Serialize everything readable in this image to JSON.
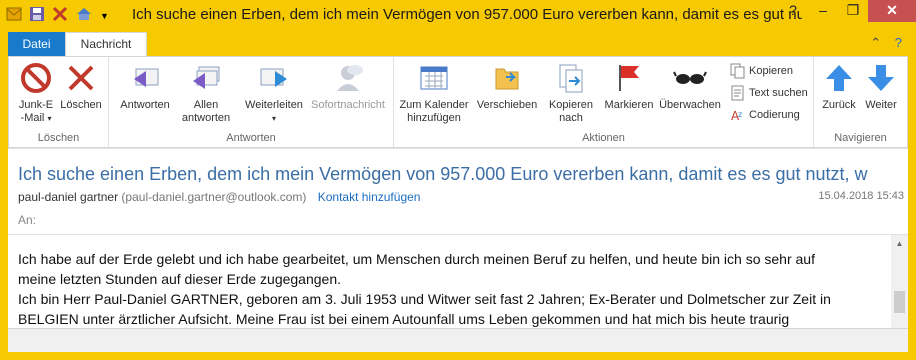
{
  "window": {
    "title": "Ich suche einen Erben, dem ich mein Vermögen von 957.000 Euro vererben kann, damit es es gut nut...",
    "help_icon": "?",
    "controls": [
      "–",
      "❐",
      "✕"
    ]
  },
  "quick_access": {
    "icons": [
      "outlook-icon",
      "save-icon",
      "delete-icon",
      "move-icon",
      "dropdown-icon"
    ]
  },
  "tabs": {
    "file": "Datei",
    "message": "Nachricht"
  },
  "ribbon": {
    "groups": {
      "delete": "Löschen",
      "respond": "Antworten",
      "actions": "Aktionen",
      "navigate": "Navigieren"
    },
    "buttons": {
      "junk": "Junk-E\n-Mail",
      "junk_arrow": "▾",
      "delete": "Löschen",
      "reply": "Antworten",
      "reply_all_1": "Allen",
      "reply_all_2": "antworten",
      "forward": "Weiterleiten",
      "forward_arrow": "▾",
      "instant_message": "Sofortnachricht",
      "calendar_1": "Zum Kalender",
      "calendar_2": "hinzufügen",
      "move": "Verschieben",
      "copy_to_1": "Kopieren",
      "copy_to_2": "nach",
      "flag": "Markieren",
      "watch": "Überwachen",
      "copy": "Kopieren",
      "find": "Text suchen",
      "encoding": "Codierung",
      "back": "Zurück",
      "next": "Weiter"
    }
  },
  "message": {
    "subject": "Ich suche einen Erben, dem ich mein Vermögen von 957.000 Euro vererben kann, damit es es gut nutzt, w",
    "sender_name": "paul-daniel gartner",
    "sender_email": "(paul-daniel.gartner@outlook.com)",
    "add_contact": "Kontakt hinzufügen",
    "date": "15.04.2018 15:43",
    "to_label": "An:",
    "body_lines": [
      "Ich habe auf der Erde gelebt und ich habe gearbeitet, um Menschen durch meinen Beruf zu helfen, und heute bin ich so sehr auf",
      "meine letzten Stunden auf dieser Erde zugegangen.",
      "Ich bin Herr Paul-Daniel GARTNER, geboren am 3. Juli 1953 und Witwer seit fast 2 Jahren; Ex-Berater und Dolmetscher zur Zeit in",
      "BELGIEN unter ärztlicher Aufsicht. Meine Frau ist bei einem Autounfall ums Leben gekommen und hat mich bis heute traurig"
    ]
  }
}
